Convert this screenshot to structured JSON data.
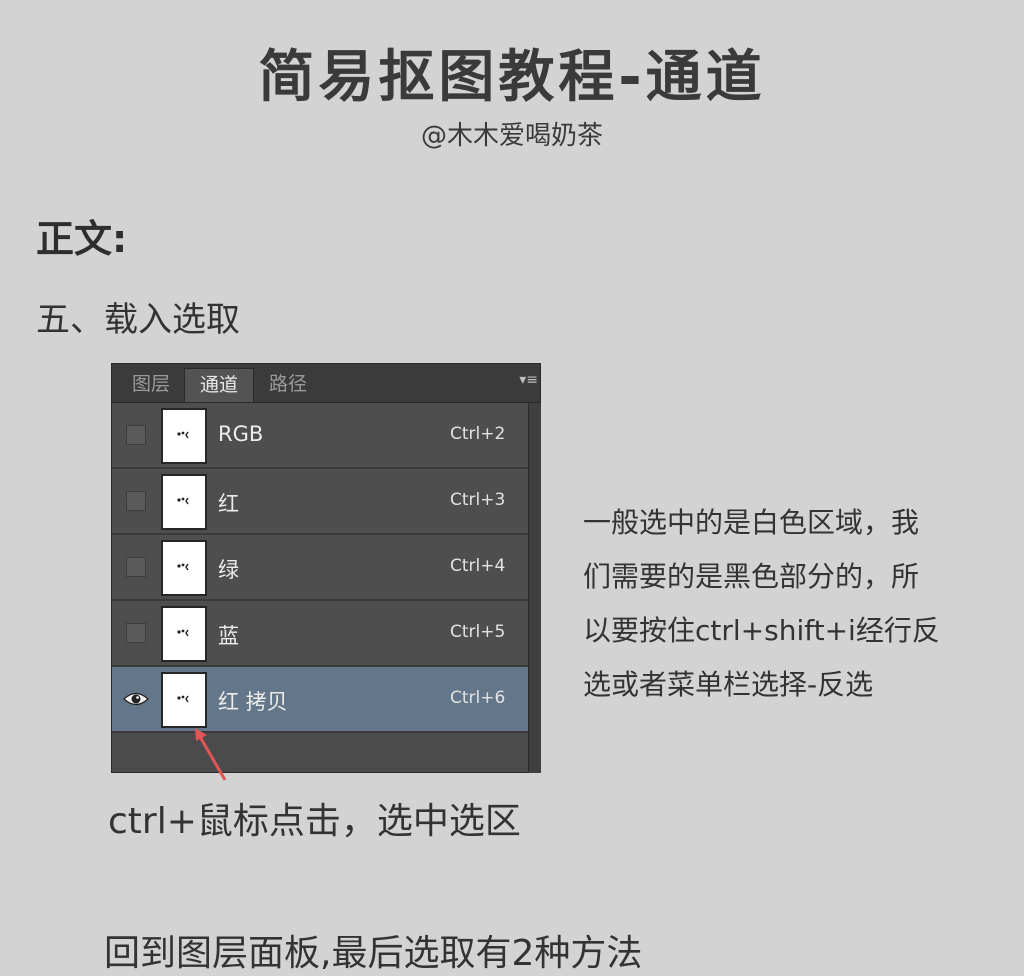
{
  "title": "简易抠图教程-通道",
  "author": "@木木爱喝奶茶",
  "section": "正文:",
  "step": "五、载入选取",
  "panel": {
    "tabs": [
      "图层",
      "通道",
      "路径"
    ],
    "active_tab": 1,
    "channels": [
      {
        "name": "RGB",
        "shortcut": "Ctrl+2",
        "visible": false,
        "selected": false
      },
      {
        "name": "红",
        "shortcut": "Ctrl+3",
        "visible": false,
        "selected": false
      },
      {
        "name": "绿",
        "shortcut": "Ctrl+4",
        "visible": false,
        "selected": false
      },
      {
        "name": "蓝",
        "shortcut": "Ctrl+5",
        "visible": false,
        "selected": false
      },
      {
        "name": "红 拷贝",
        "shortcut": "Ctrl+6",
        "visible": true,
        "selected": true
      }
    ]
  },
  "ctrl_caption": "ctrl+鼠标点击，选中选区",
  "description": [
    "一般选中的是白色区域，我",
    "们需要的是黑色部分的，所",
    "以要按住ctrl+shift+i经行反",
    "选或者菜单栏选择-反选"
  ],
  "footer": "回到图层面板,最后选取有2种方法",
  "colors": {
    "background": "#d3d3d3",
    "panel": "#4e4e4e",
    "selected_row": "#647689",
    "arrow": "#e25555"
  },
  "icons": {
    "visibility": "eye-icon",
    "menu": "panel-menu-icon",
    "pointer": "arrow-icon"
  }
}
